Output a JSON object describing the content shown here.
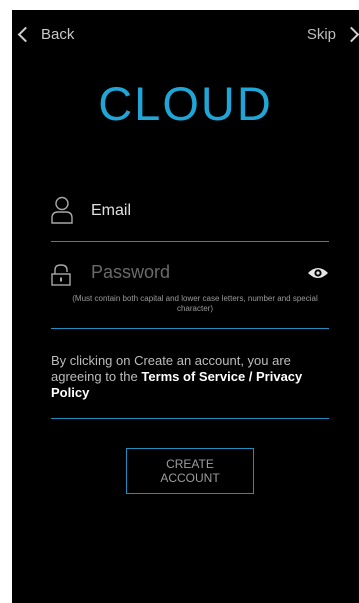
{
  "nav": {
    "back_label": "Back",
    "skip_label": "Skip"
  },
  "logo": {
    "text": "CLOUD"
  },
  "email": {
    "label": "Email"
  },
  "password": {
    "placeholder": "Password",
    "hint": "(Must contain both capital and lower case letters, number and special character)"
  },
  "terms": {
    "prefix": "By clicking on Create an account, you are agreeing to the ",
    "link": "Terms of Service / Privacy Policy"
  },
  "create_button": {
    "label": "CREATE ACCOUNT"
  },
  "colors": {
    "accent": "#1fa6d6",
    "background": "#000000"
  },
  "icons": [
    "chevron-left-icon",
    "chevron-right-icon",
    "user-icon",
    "lock-icon",
    "eye-icon"
  ]
}
